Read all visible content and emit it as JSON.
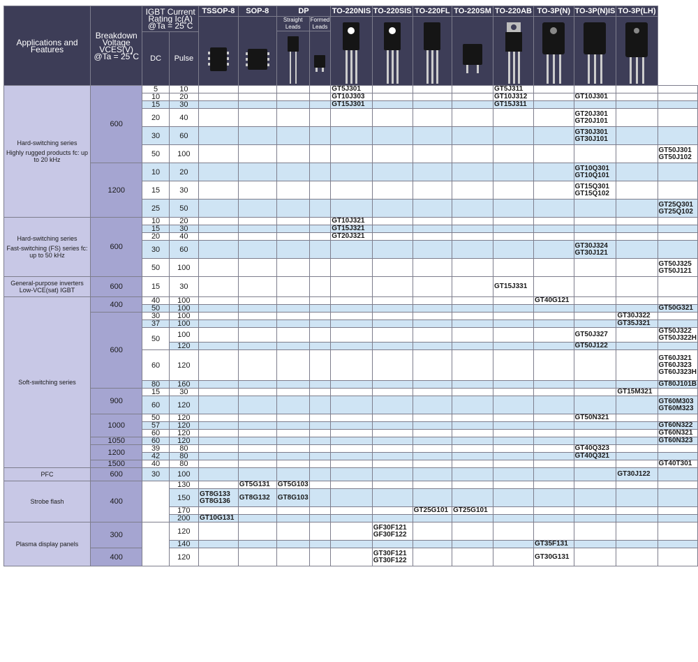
{
  "header": {
    "applications": "Applications and Features",
    "breakdown": [
      "Breakdown",
      "Voltage",
      "VCES(V)",
      "@Ta = 25˚C"
    ],
    "igbt": [
      "IGBT Current",
      "Rating Ic(A)",
      "@Ta = 25˚C"
    ],
    "dc": "DC",
    "pulse": "Pulse",
    "packages": [
      "TSSOP-8",
      "SOP-8",
      "DP",
      "TO-220NIS",
      "TO-220SIS",
      "TO-220FL",
      "TO-220SM",
      "TO-220AB",
      "TO-3P(N)",
      "TO-3P(N)IS",
      "TO-3P(LH)"
    ],
    "dp_straight": [
      "Straight",
      "Leads"
    ],
    "dp_formed": [
      "Formed",
      "Leads"
    ]
  },
  "colors": {
    "header": "#3d3d57",
    "app": "#c8c8e6",
    "voltage": "#a5a5d1",
    "shade": "#cfe4f4"
  },
  "groups": [
    {
      "app": [
        "Hard-switching series",
        "Highly rugged products fc: up to 20 kHz"
      ]
    },
    {
      "app": [
        "Hard-switching series",
        "Fast-switching (FS) series fc: up to 50 kHz"
      ]
    },
    {
      "app": [
        "General-purpose inverters Low-VCE(sat) IGBT"
      ]
    },
    {
      "app": [
        "Soft-switching series"
      ]
    },
    {
      "app": [
        "PFC"
      ]
    },
    {
      "app": [
        "Strobe flash"
      ]
    },
    {
      "app": [
        "Plasma display panels"
      ]
    }
  ],
  "voltages": [
    "600",
    "1200",
    "600",
    "600",
    "400",
    "600",
    "900",
    "1000",
    "1050",
    "1200",
    "1500",
    "600",
    "400",
    "300",
    "400"
  ],
  "rows": [
    {
      "dc": "5",
      "pulse": "10",
      "parts": [
        "",
        "",
        "",
        "",
        "GT5J301",
        "",
        "",
        "",
        "GT5J311",
        "",
        "",
        "",
        ""
      ]
    },
    {
      "dc": "10",
      "pulse": "20",
      "parts": [
        "",
        "",
        "",
        "",
        "GT10J303",
        "",
        "",
        "",
        "GT10J312",
        "",
        "GT10J301",
        "",
        ""
      ]
    },
    {
      "dc": "15",
      "pulse": "30",
      "parts": [
        "",
        "",
        "",
        "",
        "GT15J301",
        "",
        "",
        "",
        "GT15J311",
        "",
        "",
        "",
        ""
      ]
    },
    {
      "dc": "20",
      "pulse": "40",
      "parts": [
        "",
        "",
        "",
        "",
        "",
        "",
        "",
        "",
        "",
        "",
        "GT20J301\nGT20J101",
        "",
        ""
      ]
    },
    {
      "dc": "30",
      "pulse": "60",
      "parts": [
        "",
        "",
        "",
        "",
        "",
        "",
        "",
        "",
        "",
        "",
        "GT30J301\nGT30J101",
        "",
        ""
      ]
    },
    {
      "dc": "50",
      "pulse": "100",
      "parts": [
        "",
        "",
        "",
        "",
        "",
        "",
        "",
        "",
        "",
        "",
        "",
        "",
        "GT50J301\nGT50J102"
      ]
    },
    {
      "dc": "10",
      "pulse": "20",
      "parts": [
        "",
        "",
        "",
        "",
        "",
        "",
        "",
        "",
        "",
        "",
        "GT10Q301\nGT10Q101",
        "",
        ""
      ]
    },
    {
      "dc": "15",
      "pulse": "30",
      "parts": [
        "",
        "",
        "",
        "",
        "",
        "",
        "",
        "",
        "",
        "",
        "GT15Q301\nGT15Q102",
        "",
        ""
      ]
    },
    {
      "dc": "25",
      "pulse": "50",
      "parts": [
        "",
        "",
        "",
        "",
        "",
        "",
        "",
        "",
        "",
        "",
        "",
        "",
        "GT25Q301\nGT25Q102"
      ]
    },
    {
      "dc": "10",
      "pulse": "20",
      "parts": [
        "",
        "",
        "",
        "",
        "GT10J321",
        "",
        "",
        "",
        "",
        "",
        "",
        "",
        ""
      ]
    },
    {
      "dc": "15",
      "pulse": "30",
      "parts": [
        "",
        "",
        "",
        "",
        "GT15J321",
        "",
        "",
        "",
        "",
        "",
        "",
        "",
        ""
      ]
    },
    {
      "dc": "20",
      "pulse": "40",
      "parts": [
        "",
        "",
        "",
        "",
        "GT20J321",
        "",
        "",
        "",
        "",
        "",
        "",
        "",
        ""
      ]
    },
    {
      "dc": "30",
      "pulse": "60",
      "parts": [
        "",
        "",
        "",
        "",
        "",
        "",
        "",
        "",
        "",
        "",
        "GT30J324\nGT30J121",
        "",
        ""
      ]
    },
    {
      "dc": "50",
      "pulse": "100",
      "parts": [
        "",
        "",
        "",
        "",
        "",
        "",
        "",
        "",
        "",
        "",
        "",
        "",
        "GT50J325\nGT50J121"
      ]
    },
    {
      "dc": "15",
      "pulse": "30",
      "parts": [
        "",
        "",
        "",
        "",
        "",
        "",
        "",
        "",
        "GT15J331",
        "",
        "",
        "",
        ""
      ]
    },
    {
      "dc": "40",
      "pulse": "100",
      "parts": [
        "",
        "",
        "",
        "",
        "",
        "",
        "",
        "",
        "",
        "GT40G121",
        "",
        "",
        ""
      ]
    },
    {
      "dc": "50",
      "pulse": "100",
      "parts": [
        "",
        "",
        "",
        "",
        "",
        "",
        "",
        "",
        "",
        "",
        "",
        "",
        "GT50G321"
      ]
    },
    {
      "dc": "30",
      "pulse": "100",
      "parts": [
        "",
        "",
        "",
        "",
        "",
        "",
        "",
        "",
        "",
        "",
        "",
        "GT30J322",
        ""
      ]
    },
    {
      "dc": "37",
      "pulse": "100",
      "parts": [
        "",
        "",
        "",
        "",
        "",
        "",
        "",
        "",
        "",
        "",
        "",
        "GT35J321",
        ""
      ]
    },
    {
      "dc": "50",
      "pulse": "100",
      "parts": [
        "",
        "",
        "",
        "",
        "",
        "",
        "",
        "",
        "",
        "",
        "GT50J327",
        "",
        "GT50J322\nGT50J322H"
      ]
    },
    {
      "pulse": "120",
      "parts": [
        "",
        "",
        "",
        "",
        "",
        "",
        "",
        "",
        "",
        "",
        "GT50J122",
        "",
        ""
      ]
    },
    {
      "dc": "60",
      "pulse": "120",
      "parts": [
        "",
        "",
        "",
        "",
        "",
        "",
        "",
        "",
        "",
        "",
        "",
        "",
        "GT60J321\nGT60J323\nGT60J323H"
      ]
    },
    {
      "dc": "80",
      "pulse": "160",
      "parts": [
        "",
        "",
        "",
        "",
        "",
        "",
        "",
        "",
        "",
        "",
        "",
        "",
        "GT80J101B"
      ]
    },
    {
      "dc": "15",
      "pulse": "30",
      "parts": [
        "",
        "",
        "",
        "",
        "",
        "",
        "",
        "",
        "",
        "",
        "",
        "GT15M321",
        ""
      ]
    },
    {
      "dc": "60",
      "pulse": "120",
      "parts": [
        "",
        "",
        "",
        "",
        "",
        "",
        "",
        "",
        "",
        "",
        "",
        "",
        "GT60M303\nGT60M323"
      ]
    },
    {
      "dc": "50",
      "pulse": "120",
      "parts": [
        "",
        "",
        "",
        "",
        "",
        "",
        "",
        "",
        "",
        "",
        "GT50N321",
        "",
        ""
      ]
    },
    {
      "dc": "57",
      "pulse": "120",
      "parts": [
        "",
        "",
        "",
        "",
        "",
        "",
        "",
        "",
        "",
        "",
        "",
        "",
        "GT60N322"
      ]
    },
    {
      "dc": "60",
      "pulse": "120",
      "parts": [
        "",
        "",
        "",
        "",
        "",
        "",
        "",
        "",
        "",
        "",
        "",
        "",
        "GT60N321"
      ]
    },
    {
      "dc": "60",
      "pulse": "120",
      "parts": [
        "",
        "",
        "",
        "",
        "",
        "",
        "",
        "",
        "",
        "",
        "",
        "",
        "GT60N323"
      ]
    },
    {
      "dc": "39",
      "pulse": "80",
      "parts": [
        "",
        "",
        "",
        "",
        "",
        "",
        "",
        "",
        "",
        "",
        "GT40Q323",
        "",
        ""
      ]
    },
    {
      "dc": "42",
      "pulse": "80",
      "parts": [
        "",
        "",
        "",
        "",
        "",
        "",
        "",
        "",
        "",
        "",
        "GT40Q321",
        "",
        ""
      ]
    },
    {
      "dc": "40",
      "pulse": "80",
      "parts": [
        "",
        "",
        "",
        "",
        "",
        "",
        "",
        "",
        "",
        "",
        "",
        "",
        "GT40T301"
      ]
    },
    {
      "dc": "30",
      "pulse": "100",
      "parts": [
        "",
        "",
        "",
        "",
        "",
        "",
        "",
        "",
        "",
        "",
        "",
        "GT30J122",
        ""
      ]
    },
    {
      "pulse": "130",
      "parts": [
        "",
        "GT5G131",
        "GT5G103",
        "",
        "",
        "",
        "",
        "",
        "",
        "",
        "",
        "",
        ""
      ]
    },
    {
      "pulse": "150",
      "parts": [
        "GT8G133\nGT8G136",
        "GT8G132",
        "GT8G103",
        "",
        "",
        "",
        "",
        "",
        "",
        "",
        "",
        "",
        ""
      ]
    },
    {
      "pulse": "170",
      "parts": [
        "",
        "",
        "",
        "",
        "",
        "",
        "GT25G101",
        "GT25G101",
        "",
        "",
        "",
        "",
        ""
      ]
    },
    {
      "pulse": "200",
      "parts": [
        "GT10G131",
        "",
        "",
        "",
        "",
        "",
        "",
        "",
        "",
        "",
        "",
        "",
        ""
      ]
    },
    {
      "pulse": "120",
      "parts": [
        "",
        "",
        "",
        "",
        "",
        "GF30F121\nGF30F122",
        "",
        "",
        "",
        "",
        "",
        "",
        ""
      ]
    },
    {
      "pulse": "140",
      "parts": [
        "",
        "",
        "",
        "",
        "",
        "",
        "",
        "",
        "",
        "GT35F131",
        "",
        "",
        ""
      ]
    },
    {
      "pulse": "120",
      "parts": [
        "",
        "",
        "",
        "",
        "",
        "GT30F121\nGT30F122",
        "",
        "",
        "",
        "GT30G131",
        "",
        "",
        ""
      ]
    }
  ]
}
